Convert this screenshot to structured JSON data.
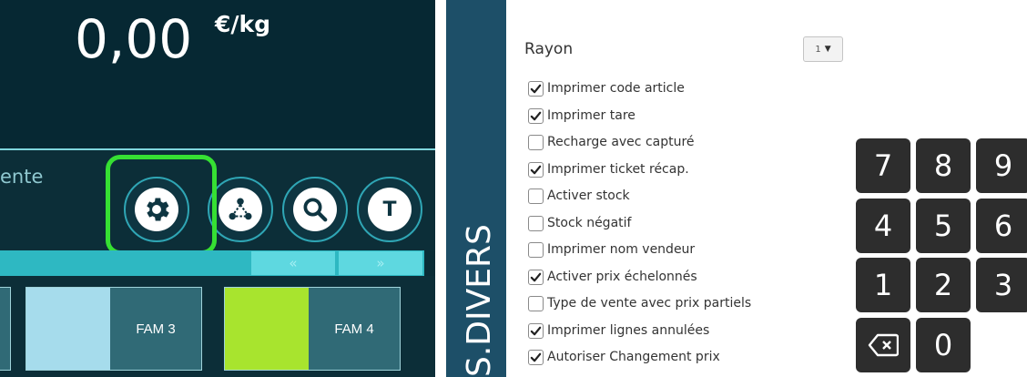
{
  "price": {
    "value": "0,00",
    "unit": "€/kg"
  },
  "mode_label": "ente",
  "toolbar": {
    "settings_icon": "gear-icon",
    "network_icon": "network-icon",
    "search_icon": "search-icon",
    "tare_letter": "T"
  },
  "nav": {
    "prev": "«",
    "next": "»"
  },
  "families": [
    {
      "label": "FAM 3",
      "color": "#a6dcec"
    },
    {
      "label": "FAM 4",
      "color": "#a8e42e"
    }
  ],
  "vertical_title": "S.DIVERS",
  "rayon": {
    "label": "Rayon",
    "selected": "1"
  },
  "options": [
    {
      "label": "Imprimer code article",
      "checked": true
    },
    {
      "label": "Imprimer tare",
      "checked": true
    },
    {
      "label": "Recharge avec capturé",
      "checked": false
    },
    {
      "label": "Imprimer ticket récap.",
      "checked": true
    },
    {
      "label": "Activer stock",
      "checked": false
    },
    {
      "label": "Stock négatif",
      "checked": false
    },
    {
      "label": "Imprimer nom vendeur",
      "checked": false
    },
    {
      "label": "Activer prix échelonnés",
      "checked": true
    },
    {
      "label": "Type de vente avec prix partiels",
      "checked": false
    },
    {
      "label": "Imprimer lignes annulées",
      "checked": true
    },
    {
      "label": "Autoriser Changement prix",
      "checked": true
    }
  ],
  "keypad": {
    "keys": [
      "7",
      "8",
      "9",
      "4",
      "5",
      "6",
      "1",
      "2",
      "3"
    ],
    "backspace_icon": "backspace-icon",
    "zero": "0"
  },
  "colors": {
    "highlight": "#36e033",
    "accent": "#2eb8c2",
    "vertical_bar": "#1d4f68"
  }
}
